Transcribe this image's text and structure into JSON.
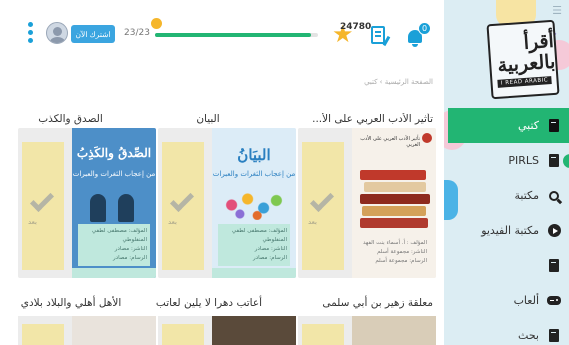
{
  "header": {
    "subscribe_label": "اشترك الآن",
    "progress": {
      "text": "23/23",
      "fraction": 0.96
    },
    "points": "24780",
    "notifications_count": "0"
  },
  "sidebar": {
    "logo_ar": "أقرأ بالعربية",
    "logo_en": "I READ ARABIC",
    "items": [
      {
        "label": "كتبي",
        "icon": "book-icon",
        "active": true
      },
      {
        "label": "PIRLS",
        "icon": "book-icon",
        "active": false
      },
      {
        "label": "مكتبة",
        "icon": "search-icon",
        "active": false
      },
      {
        "label": "مكتبة الفيديو",
        "icon": "play-icon",
        "active": false
      },
      {
        "label": "",
        "icon": "book-icon",
        "active": false
      },
      {
        "label": "ألعاب",
        "icon": "gamepad-icon",
        "active": false
      },
      {
        "label": "بحث",
        "icon": "book-icon",
        "active": false
      }
    ]
  },
  "breadcrumb": "الصفحة الرئيسية  ›  كتبي",
  "books_row1": [
    {
      "title": "تأثير الأدب العربي على الأ...",
      "cover_title": "تأثير الأدب العربي على الأدب الغربي",
      "cover_info": "المؤلف : أ. أسماء بنت الفهد\nالناشر: مجموعة أسلم\nالرسام: مجموعة أسلم",
      "bookmark_text": "بعد"
    },
    {
      "title": "البيان",
      "cover_title": "البيَانُ",
      "cover_sub": "من إعجاب الثغرات والعبرات",
      "cover_info": "المؤلف: مصطفى لطفي المنفلوطي\nالناشر: مصادر\nالرسام: مصادر",
      "bookmark_text": "بعد"
    },
    {
      "title": "الصدق والكذب",
      "cover_title": "الصِّدقُ والكَذِبُ",
      "cover_sub": "من إعجاب الثغرات والعبرات",
      "cover_info": "المؤلف: مصطفى لطفي المنفلوطي\nالناشر: مصادر\nالرسام: مصادر",
      "bookmark_text": "بعد"
    }
  ],
  "books_row2": [
    {
      "title": "معلقة زهير بن أبي سلمى"
    },
    {
      "title": "أعاتب دهرا لا يلين لعاتب"
    },
    {
      "title": "الأهل أهلي والبلاد بلادي"
    }
  ],
  "colors": {
    "accent_green": "#22b573",
    "accent_blue": "#1aa0d8",
    "star": "#f5b62b",
    "sidebar_bg": "#dcedf3"
  }
}
